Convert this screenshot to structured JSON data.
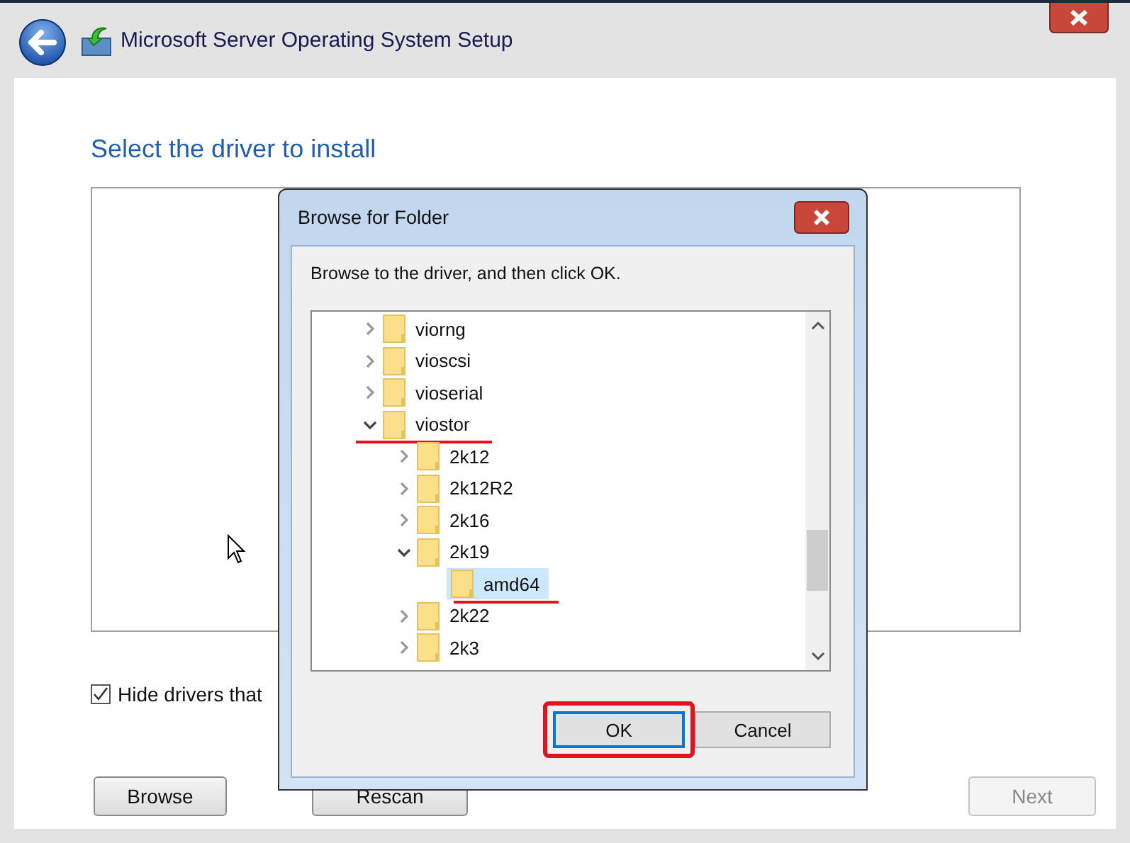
{
  "window": {
    "title": "Microsoft Server Operating System Setup"
  },
  "page": {
    "heading": "Select the driver to install",
    "hide_checkbox": {
      "label": "Hide drivers that",
      "checked": true
    },
    "buttons": [
      {
        "label": "Browse",
        "disabled": false
      },
      {
        "label": "Rescan",
        "disabled": false
      },
      {
        "label": "Next",
        "disabled": true
      }
    ]
  },
  "dialog": {
    "title": "Browse for Folder",
    "instruction": "Browse to the driver, and then click OK.",
    "tree": [
      {
        "label": "viorng",
        "expandable": true,
        "expanded": false,
        "selected": false,
        "annotated": false
      },
      {
        "label": "vioscsi",
        "expandable": true,
        "expanded": false,
        "selected": false,
        "annotated": false
      },
      {
        "label": "vioserial",
        "expandable": true,
        "expanded": false,
        "selected": false,
        "annotated": false
      },
      {
        "label": "viostor",
        "expandable": true,
        "expanded": true,
        "selected": false,
        "annotated": true,
        "children": [
          {
            "label": "2k12",
            "expandable": true,
            "expanded": false,
            "selected": false,
            "annotated": false
          },
          {
            "label": "2k12R2",
            "expandable": true,
            "expanded": false,
            "selected": false,
            "annotated": false
          },
          {
            "label": "2k16",
            "expandable": true,
            "expanded": false,
            "selected": false,
            "annotated": false
          },
          {
            "label": "2k19",
            "expandable": true,
            "expanded": true,
            "selected": false,
            "annotated": false,
            "children": [
              {
                "label": "amd64",
                "expandable": false,
                "selected": true,
                "annotated": true
              }
            ]
          },
          {
            "label": "2k22",
            "expandable": true,
            "expanded": false,
            "selected": false,
            "annotated": false
          },
          {
            "label": "2k3",
            "expandable": true,
            "expanded": false,
            "selected": false,
            "annotated": false
          }
        ]
      }
    ],
    "buttons": [
      {
        "label": "OK",
        "default": true,
        "annotated": true
      },
      {
        "label": "Cancel",
        "default": false,
        "annotated": false
      }
    ]
  }
}
